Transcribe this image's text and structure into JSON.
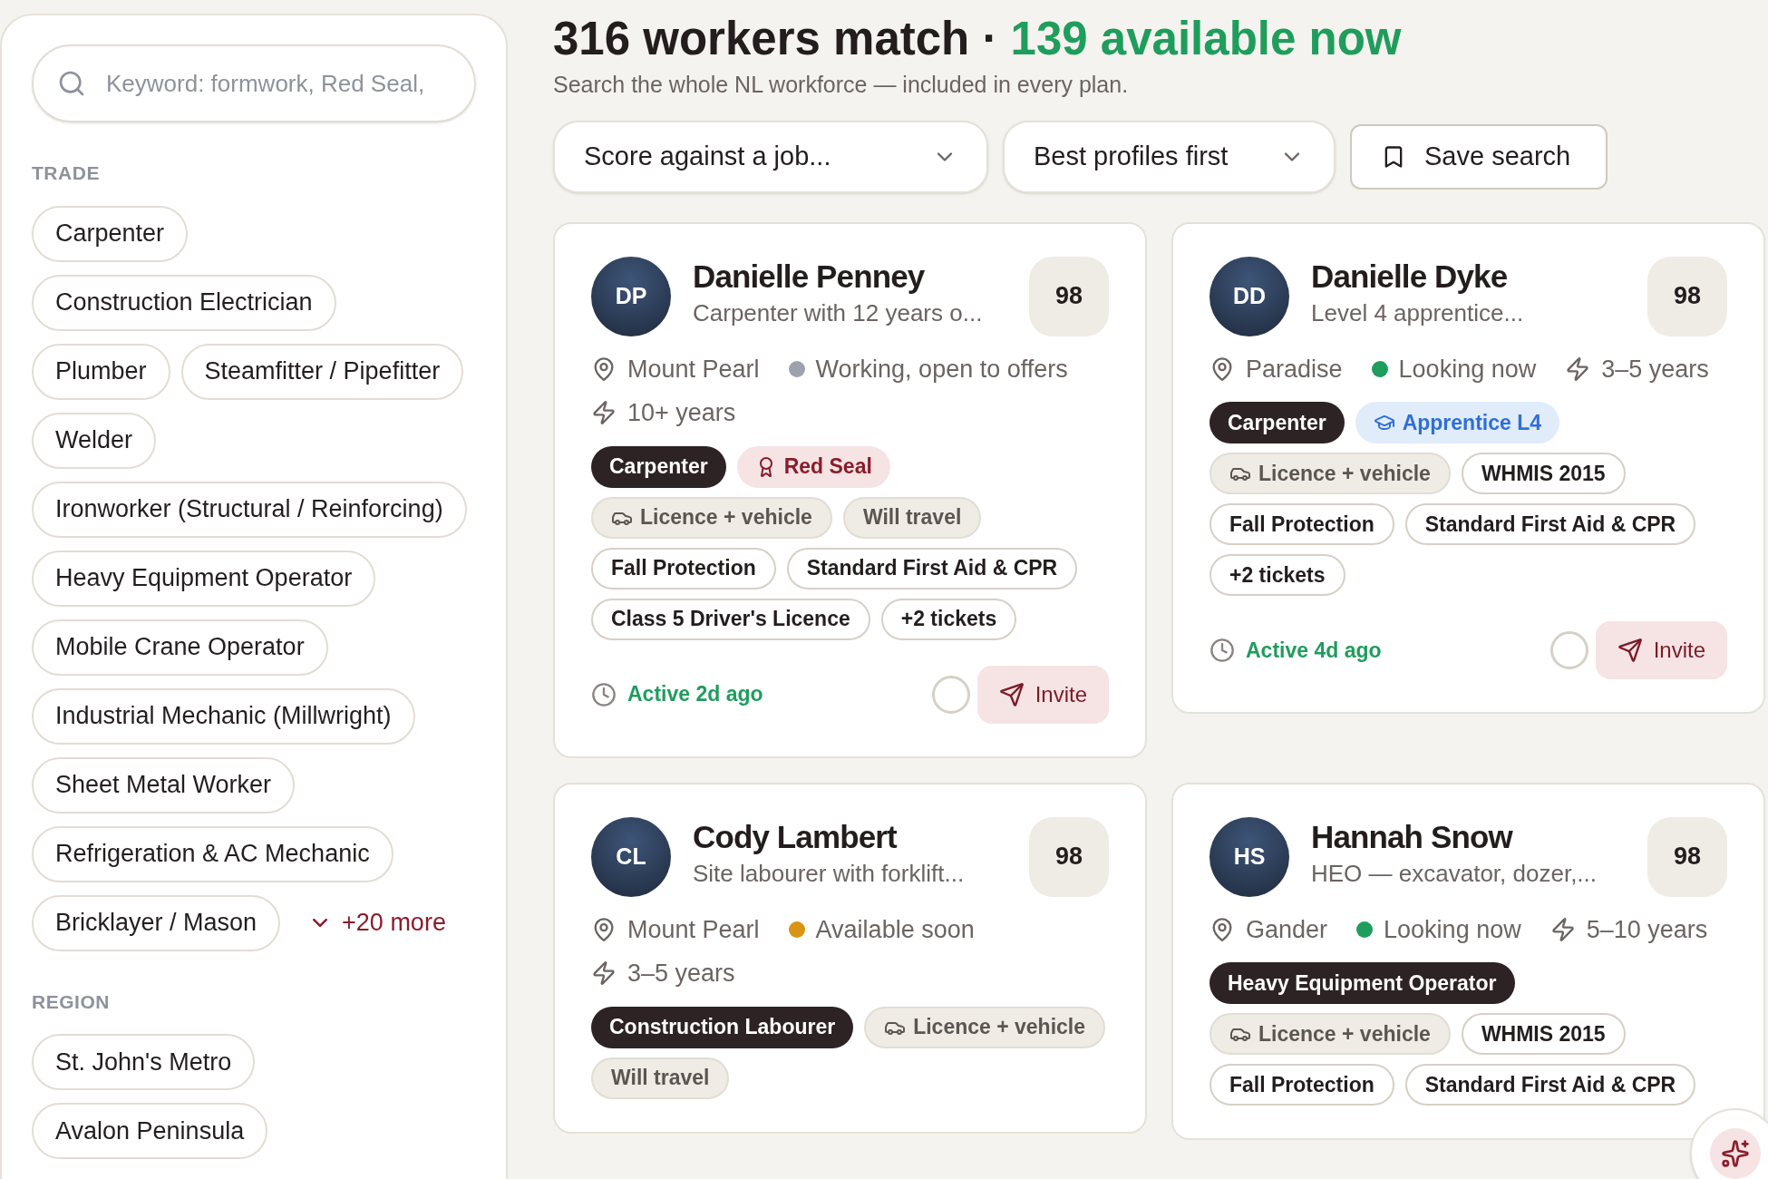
{
  "search": {
    "placeholder": "Keyword: formwork, Red Seal,"
  },
  "filters": [
    {
      "heading": "TRADE",
      "options": [
        "Carpenter",
        "Construction Electrician",
        "Plumber",
        "Steamfitter / Pipefitter",
        "Welder",
        "Ironworker (Structural / Reinforcing)",
        "Heavy Equipment Operator",
        "Mobile Crane Operator",
        "Industrial Mechanic (Millwright)",
        "Sheet Metal Worker",
        "Refrigeration & AC Mechanic",
        "Bricklayer / Mason"
      ],
      "more": "+20 more"
    },
    {
      "heading": "REGION",
      "options": [
        "St. John's Metro",
        "Avalon Peninsula"
      ]
    }
  ],
  "header": {
    "count": "316 workers match",
    "separator": "·",
    "available": "139 available now",
    "subtitle": "Search the whole NL workforce — included in every plan."
  },
  "toolbar": {
    "score_select": "Score against a job...",
    "sort_select": "Best profiles first",
    "save_button": "Save search"
  },
  "workers": [
    {
      "initials": "DP",
      "name": "Danielle Penney",
      "summary": "Carpenter with 12 years o...",
      "score": "98",
      "location": "Mount Pearl",
      "status": "Working, open to offers",
      "color": "#9ca3af",
      "experience": "10+ years",
      "tags": [
        {
          "kind": "trade",
          "label": "Carpenter"
        },
        {
          "kind": "redseal",
          "label": "Red Seal"
        },
        {
          "kind": "vehicle",
          "label": "Licence + vehicle"
        },
        {
          "kind": "feature",
          "label": "Will travel"
        },
        {
          "kind": "ticket",
          "label": "Fall Protection"
        },
        {
          "kind": "ticket",
          "label": "Standard First Aid & CPR"
        },
        {
          "kind": "ticket",
          "label": "Class 5 Driver's Licence"
        },
        {
          "kind": "ticket",
          "label": "+2 tickets"
        }
      ],
      "active": "Active 2d ago",
      "selected": false,
      "invite": "Invite"
    },
    {
      "initials": "DD",
      "name": "Danielle Dyke",
      "summary": "Level 4 apprentice...",
      "score": "98",
      "location": "Paradise",
      "status": "Looking now",
      "color": "#1f9d5c",
      "experience": "3–5 years",
      "tags": [
        {
          "kind": "trade",
          "label": "Carpenter"
        },
        {
          "kind": "apprentice",
          "label": "Apprentice L4"
        },
        {
          "kind": "vehicle",
          "label": "Licence + vehicle"
        },
        {
          "kind": "ticket",
          "label": "WHMIS 2015"
        },
        {
          "kind": "ticket",
          "label": "Fall Protection"
        },
        {
          "kind": "ticket",
          "label": "Standard First Aid & CPR"
        },
        {
          "kind": "ticket",
          "label": "+2 tickets"
        }
      ],
      "active": "Active 4d ago",
      "selected": false,
      "invite": "Invite"
    },
    {
      "initials": "CL",
      "name": "Cody Lambert",
      "summary": "Site labourer with forklift...",
      "score": "98",
      "location": "Mount Pearl",
      "status": "Available soon",
      "color": "#d99413",
      "experience": "3–5 years",
      "tags": [
        {
          "kind": "trade",
          "label": "Construction Labourer"
        },
        {
          "kind": "vehicle",
          "label": "Licence + vehicle"
        },
        {
          "kind": "feature",
          "label": "Will travel"
        }
      ]
    },
    {
      "initials": "HS",
      "name": "Hannah Snow",
      "summary": "HEO — excavator, dozer,...",
      "score": "98",
      "location": "Gander",
      "status": "Looking now",
      "color": "#1f9d5c",
      "experience": "5–10 years",
      "tags": [
        {
          "kind": "trade",
          "label": "Heavy Equipment Operator"
        },
        {
          "kind": "vehicle",
          "label": "Licence + vehicle"
        },
        {
          "kind": "ticket",
          "label": "WHMIS 2015"
        },
        {
          "kind": "ticket",
          "label": "Fall Protection"
        },
        {
          "kind": "ticket",
          "label": "Standard First Aid & CPR"
        }
      ]
    }
  ]
}
